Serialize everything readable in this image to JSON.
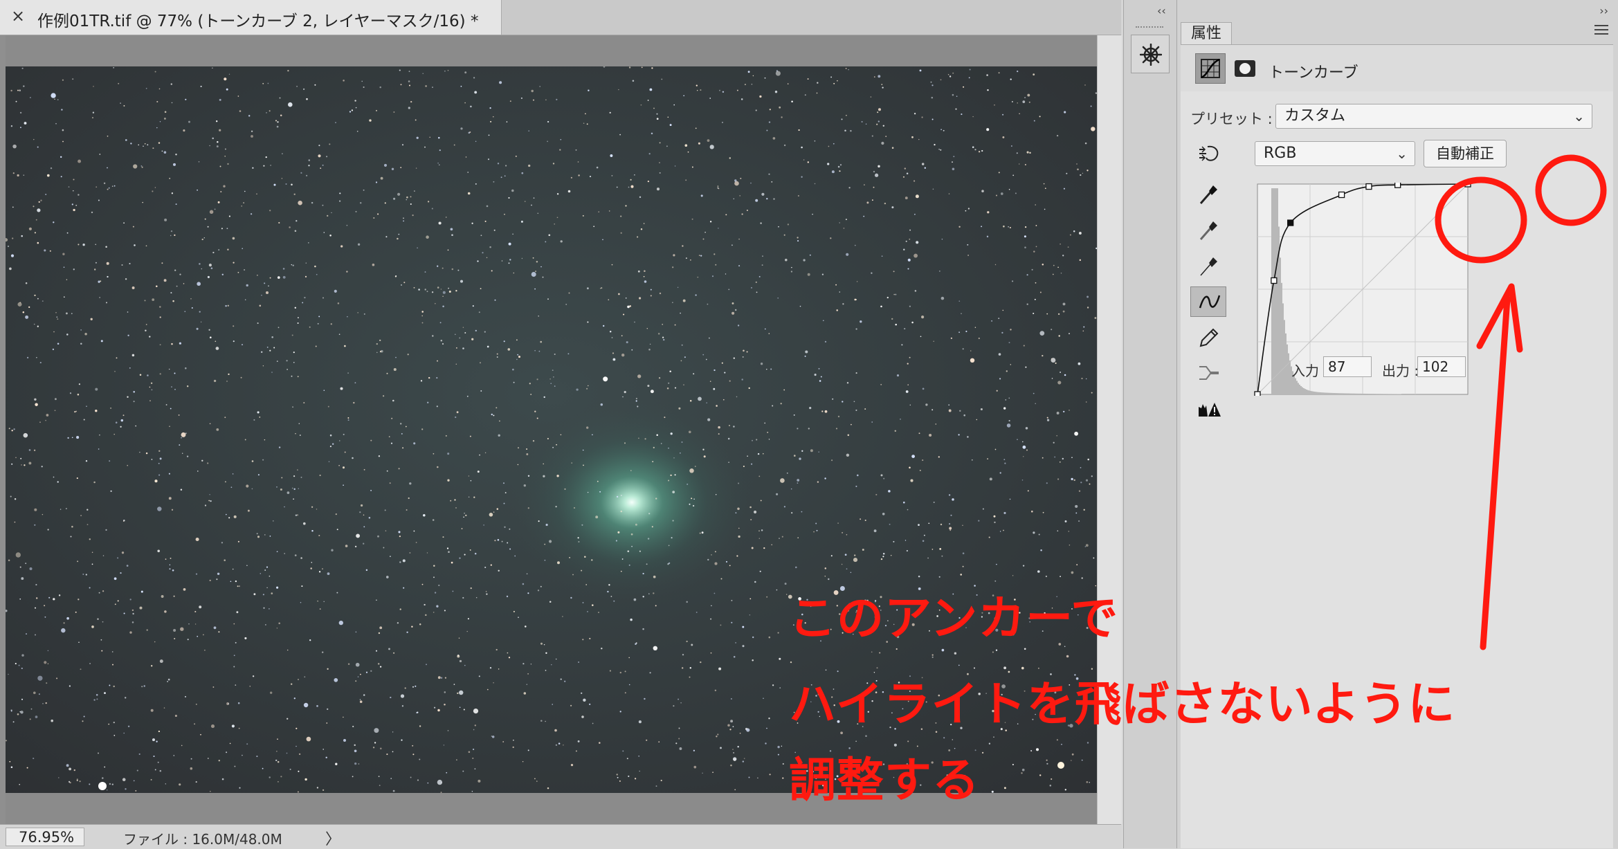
{
  "document": {
    "tab_close": "×",
    "tab_title": "作例01TR.tif @ 77% (トーンカーブ 2, レイヤーマスク/16) *",
    "zoom": "76.95%",
    "file_info": "ファイル : 16.0M/48.0M",
    "status_arrow": "〉"
  },
  "dock": {
    "collapse_arrows": "‹‹",
    "expand_arrows": "››",
    "nav_icon": "ship-wheel-icon"
  },
  "properties_panel": {
    "tab_label": "属性",
    "subtitle": "トーンカーブ",
    "preset_label": "プリセット :",
    "preset_value": "カスタム",
    "channel_value": "RGB",
    "auto_button": "自動補正",
    "tools": [
      "targeted-adjust-icon",
      "black-eyedropper-icon",
      "gray-eyedropper-icon",
      "white-eyedropper-icon",
      "curve-point-icon",
      "pencil-icon",
      "smooth-icon",
      "clipping-warning-icon"
    ],
    "input_label": "入力 :",
    "input_value": "87",
    "output_label": "出力 :",
    "output_value": "102"
  },
  "curve": {
    "anchor_points": [
      [
        0,
        0
      ],
      [
        20,
        138
      ],
      [
        40,
        208
      ],
      [
        102,
        242
      ],
      [
        135,
        252
      ],
      [
        170,
        254
      ],
      [
        255,
        255
      ]
    ],
    "selected_anchor_index": 2
  },
  "annotation": {
    "line1": "このアンカーで",
    "line2": "ハイライトを飛ばさないように",
    "line3": "調整する",
    "color": "#ff1a10"
  }
}
